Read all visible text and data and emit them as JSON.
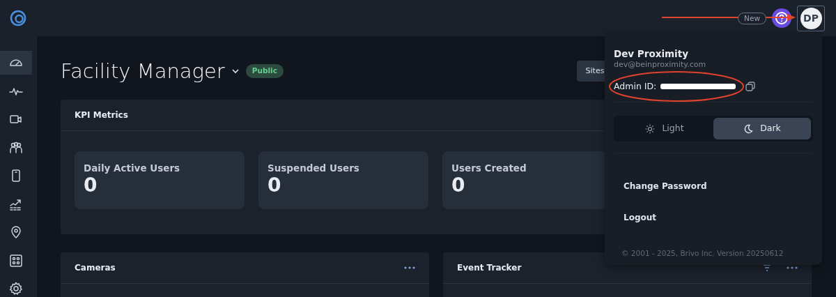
{
  "topbar": {
    "new_badge": "New",
    "avatar_initials": "DP"
  },
  "sidebar": {
    "items": [
      {
        "kind": "gauge",
        "selected": true
      },
      {
        "kind": "pulse",
        "selected": false
      },
      {
        "kind": "camera",
        "selected": false
      },
      {
        "kind": "people",
        "selected": false
      },
      {
        "kind": "phone",
        "selected": false
      },
      {
        "kind": "trend",
        "selected": false
      },
      {
        "kind": "pin",
        "selected": false
      },
      {
        "kind": "panel",
        "selected": false
      },
      {
        "kind": "gear",
        "selected": false
      }
    ]
  },
  "page": {
    "title": "Facility Manager",
    "visibility": "Public",
    "sites_button": "Sites"
  },
  "kpi": {
    "title": "KPI Metrics",
    "tiles": [
      {
        "label": "Daily Active Users",
        "value": "0"
      },
      {
        "label": "Suspended Users",
        "value": "0"
      },
      {
        "label": "Users Created",
        "value": "0"
      }
    ]
  },
  "cards": [
    {
      "title": "Cameras",
      "filter": false
    },
    {
      "title": "Event Tracker",
      "filter": true
    }
  ],
  "user_menu": {
    "name": "Dev Proximity",
    "email": "dev@beinproximity.com",
    "admin_id_label": "Admin ID:",
    "admin_id_redacted": true,
    "theme_options": [
      {
        "label": "Light",
        "kind": "sun",
        "selected": false
      },
      {
        "label": "Dark",
        "kind": "moon",
        "selected": true
      }
    ],
    "links": [
      "Change Password",
      "Logout"
    ],
    "footer": "© 2001 - 2025, Brivo Inc. Version 20250612"
  },
  "annotations": [
    {
      "kind": "arrow"
    },
    {
      "kind": "ellipse"
    }
  ]
}
